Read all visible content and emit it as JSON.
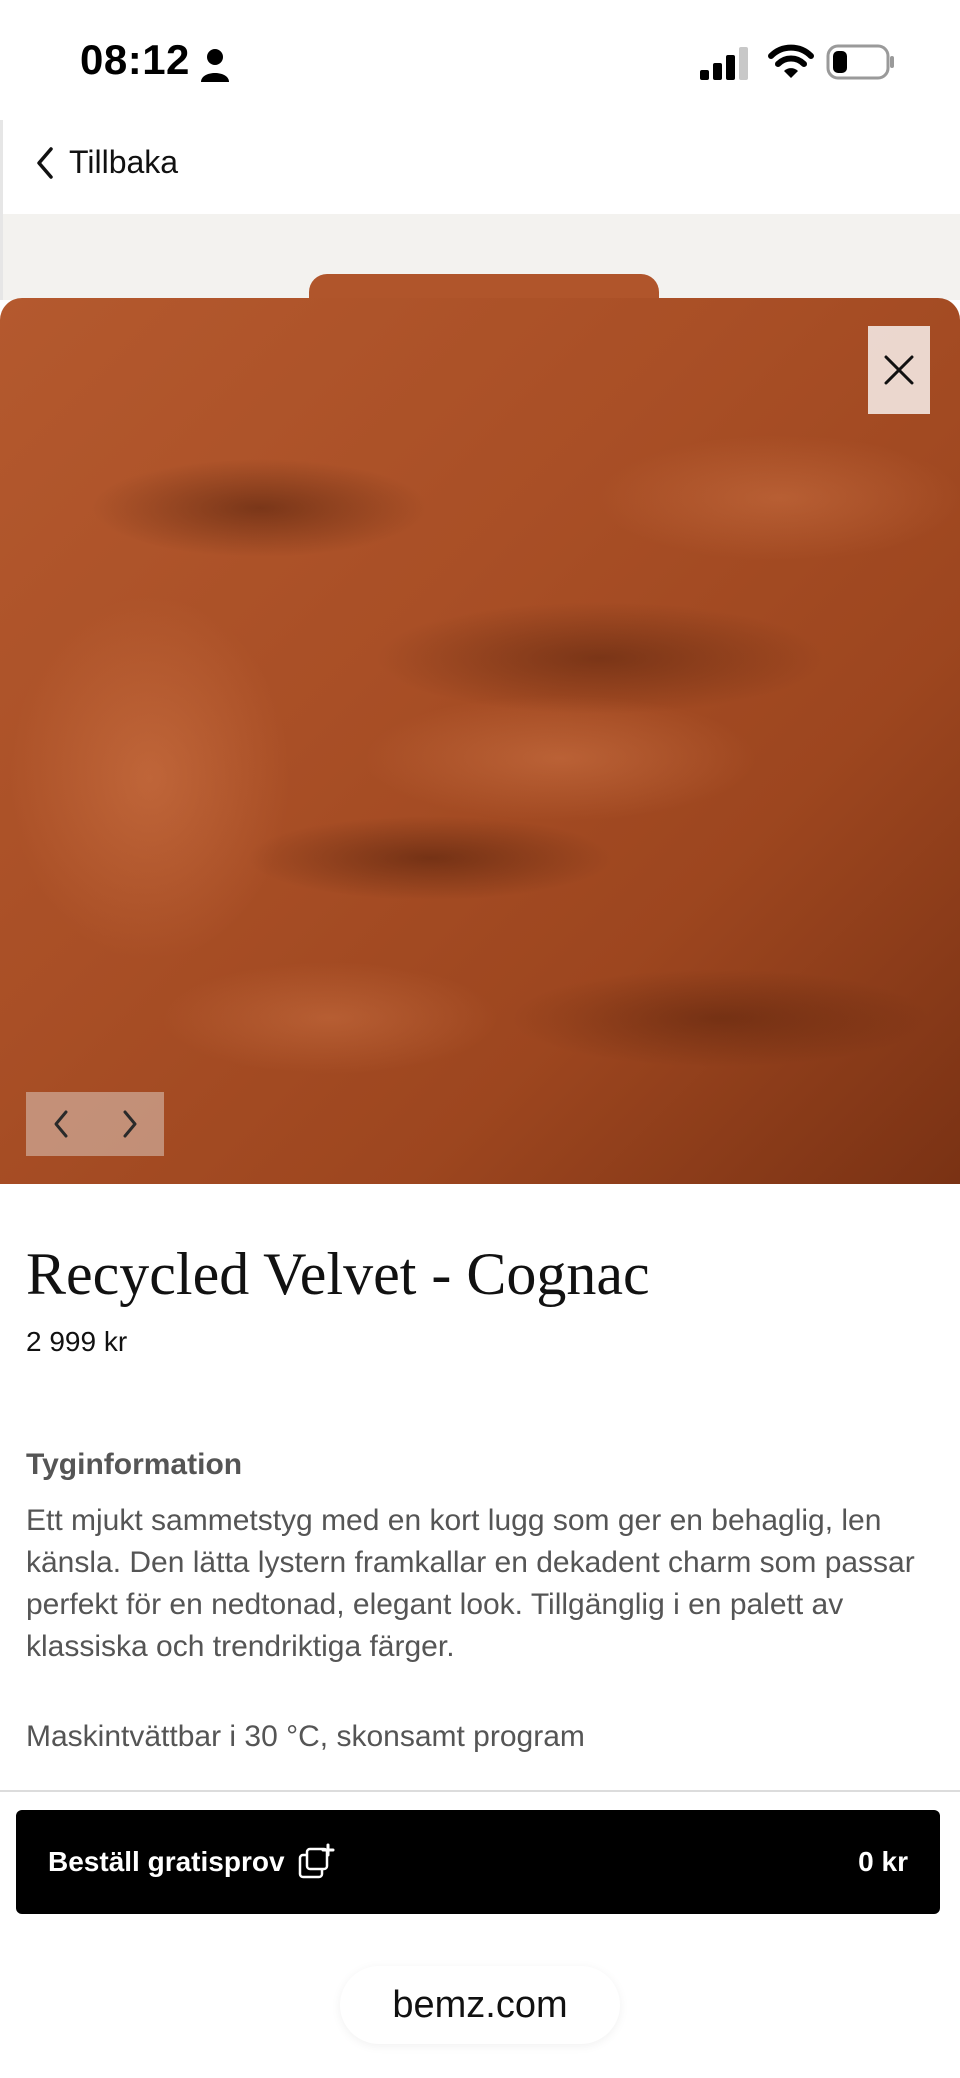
{
  "status_bar": {
    "time": "08:12"
  },
  "nav": {
    "back_label": "Tillbaka"
  },
  "product": {
    "title": "Recycled Velvet - Cognac",
    "price": "2 999 kr",
    "info_heading": "Tyginformation",
    "description": "Ett mjukt sammetstyg med en kort lugg som ger en behaglig, len känsla. Den lätta lystern framkallar en dekadent charm som passar perfekt för en nedtonad, elegant look. Tillgänglig i en palett av klassiska och trendriktiga färger.",
    "care": "Maskintvättbar i 30 °C, skonsamt program",
    "color_swatch": "#a94f26"
  },
  "order": {
    "label": "Beställ gratisprov",
    "price": "0 kr"
  },
  "browser": {
    "url": "bemz.com"
  }
}
